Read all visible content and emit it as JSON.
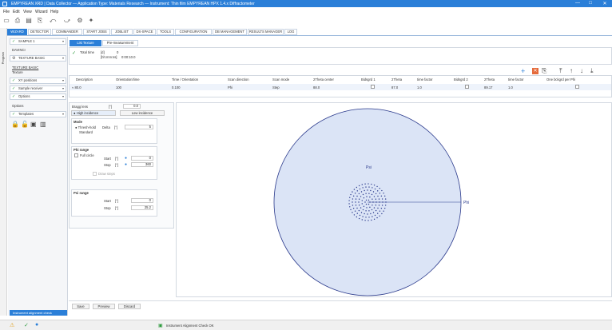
{
  "window": {
    "title": "EMPYREAN XRD | Data Collector — Application Type: Materials Research — Instrument: Thin film EMPYREAN HPX 1.4.x Diffractometer",
    "minimize": "—",
    "maximize": "□",
    "close": "✕"
  },
  "menu": [
    "File",
    "Edit",
    "View",
    "Wizard",
    "Help"
  ],
  "toolbar_icons": [
    "new-icon",
    "open-icon",
    "save-icon",
    "print-icon",
    "undo-icon",
    "redo-icon",
    "settings-icon",
    "wizard-icon"
  ],
  "tabs": [
    "WIZARD",
    "DETECTOR",
    "COMMANDER",
    "START JOBS",
    "JOBLIST",
    "DX-SPACE",
    "TOOLS",
    "CONFIGURATION",
    "DB MANAGEMENT",
    "RESULTS MANAGER",
    "LOG"
  ],
  "active_tab": 0,
  "vertical_label": "Program",
  "sidebar": {
    "items": [
      {
        "label": "SAMPLE 1",
        "check": true
      },
      {
        "label": "DAVINCI",
        "check": false,
        "plain": true
      },
      {
        "label": "TEXTURE BASIC",
        "check": false,
        "icon": "gear"
      },
      {
        "label": "TEXTURE BASIC",
        "check": false,
        "plain": true,
        "underline": true
      },
      {
        "label": "Texture",
        "check": false,
        "plain": true
      },
      {
        "label": "XY positions",
        "check": true
      },
      {
        "label": "Sample receiver",
        "check": true
      },
      {
        "label": "Options",
        "check": true
      },
      {
        "label": "Options",
        "check": false,
        "plain": true
      },
      {
        "label": "Templates",
        "check": true
      }
    ],
    "bottom_button": "Instrument alignment check"
  },
  "subtabs": [
    "List Texture",
    "Pre-measurement"
  ],
  "total_time": {
    "label": "Total time",
    "d": "[d]",
    "hms": "[hh:mm:ss]",
    "value_d": "0",
    "value_hms": "0:00:10.0"
  },
  "table": {
    "headers": [
      "Description",
      "Orientation/time",
      "Time / Orientation",
      "Scan direction",
      "Scan mode",
      "2Theta center",
      "Bidsgrd 1",
      "2Theta",
      "time factor",
      "Bidsgrd 2",
      "2Theta",
      "time factor",
      "One bckgrd per Phi"
    ],
    "row": [
      "≈ 80.0",
      "100",
      "0.100",
      "Phi",
      "Step",
      "88.0",
      "",
      "87.0",
      "1.0",
      "",
      "89.17",
      "1.0",
      ""
    ]
  },
  "right_icons": [
    "add-icon",
    "delete-icon",
    "copy-icon",
    "move-top-icon",
    "move-up-icon",
    "move-down-icon",
    "move-bottom-icon"
  ],
  "settings": {
    "bragg_label": "Bragg lens",
    "bragg_unit": "[°]",
    "bragg_value": "0.0",
    "high_incidence": "High incidence",
    "low_incidence": "Low incidence",
    "mode_title": "Mode",
    "mode_thresholded": "Thresh-hold",
    "mode_standard": "Standard",
    "delta_label": "Delta",
    "delta_unit": "[°]",
    "delta_value": "5",
    "phi_title": "Phi range",
    "full_circle": "Full circle",
    "start_label": "Start",
    "stop_label": "Stop",
    "deg_unit": "[°]",
    "phi_start": "0",
    "phi_stop": "360",
    "draw_steps": "Draw steps",
    "psi_title": "Psi range",
    "psi_start": "0",
    "psi_stop": "25.2"
  },
  "plot": {
    "psi_axis_label": "Psi",
    "phi_axis_label": "Phi",
    "fill_color": "#dbe4f6",
    "stroke_color": "#2b3a8c",
    "dot_color": "#2b3a8c"
  },
  "bottom_buttons": [
    "Save",
    "Preview",
    "Discard"
  ],
  "status": {
    "text": "Instrument Alignment Check OK"
  },
  "colors": {
    "accent": "#2b7fd8",
    "ok": "#2e9b3e"
  }
}
